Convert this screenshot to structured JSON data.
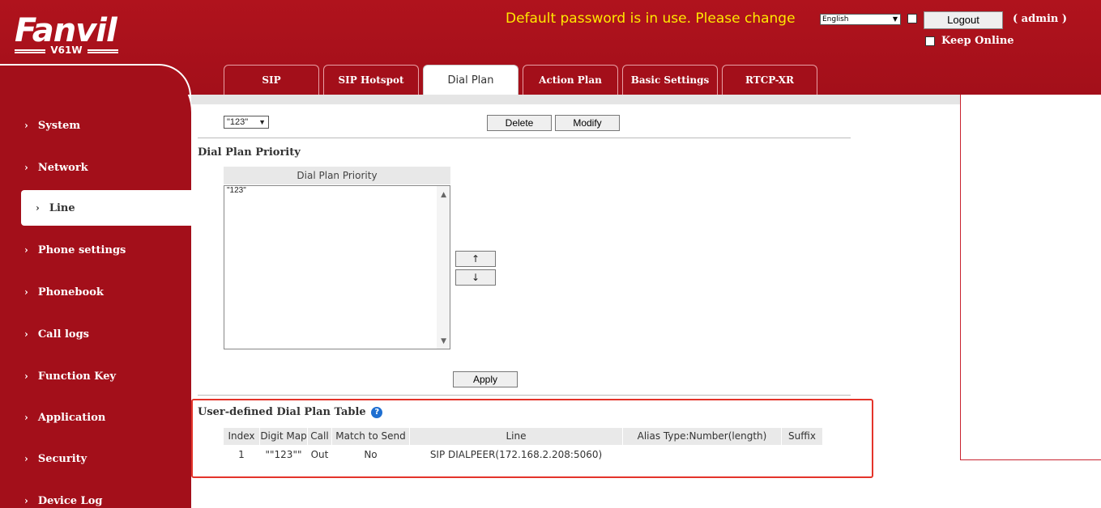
{
  "header": {
    "brand": "Fanvil",
    "model": "V61W",
    "warning": "Default password is in use. Please change",
    "language": "English",
    "logout_label": "Logout",
    "user_label": "( admin )",
    "keep_online_label": "Keep Online"
  },
  "sidebar": {
    "items": [
      {
        "label": "System"
      },
      {
        "label": "Network"
      },
      {
        "label": "Line",
        "active": true
      },
      {
        "label": "Phone settings"
      },
      {
        "label": "Phonebook"
      },
      {
        "label": "Call logs"
      },
      {
        "label": "Function Key"
      },
      {
        "label": "Application"
      },
      {
        "label": "Security"
      },
      {
        "label": "Device Log"
      }
    ]
  },
  "tabs": [
    {
      "label": "SIP"
    },
    {
      "label": "SIP Hotspot"
    },
    {
      "label": "Dial Plan",
      "active": true
    },
    {
      "label": "Action Plan"
    },
    {
      "label": "Basic Settings"
    },
    {
      "label": "RTCP-XR"
    }
  ],
  "dial_plan_select": {
    "value": "\"123\"",
    "delete_label": "Delete",
    "modify_label": "Modify"
  },
  "priority": {
    "section_title": "Dial Plan Priority",
    "list_header": "Dial Plan Priority",
    "items": [
      "\"123\""
    ],
    "up_label": "↑",
    "down_label": "↓",
    "apply_label": "Apply"
  },
  "user_table": {
    "title": "User-defined Dial Plan Table",
    "help_icon": "question-icon",
    "columns": [
      "Index",
      "Digit Map",
      "Call",
      "Match to Send",
      "Line",
      "Alias Type:Number(length)",
      "Suffix"
    ],
    "rows": [
      [
        "1",
        "\"\"123\"\"",
        "Out",
        "No",
        "SIP DIALPEER(172.168.2.208:5060)",
        "",
        ""
      ]
    ]
  },
  "colors": {
    "brand_red": "#a30f1a",
    "warning_yellow": "#ffe800",
    "highlight_red": "#e4342a"
  }
}
